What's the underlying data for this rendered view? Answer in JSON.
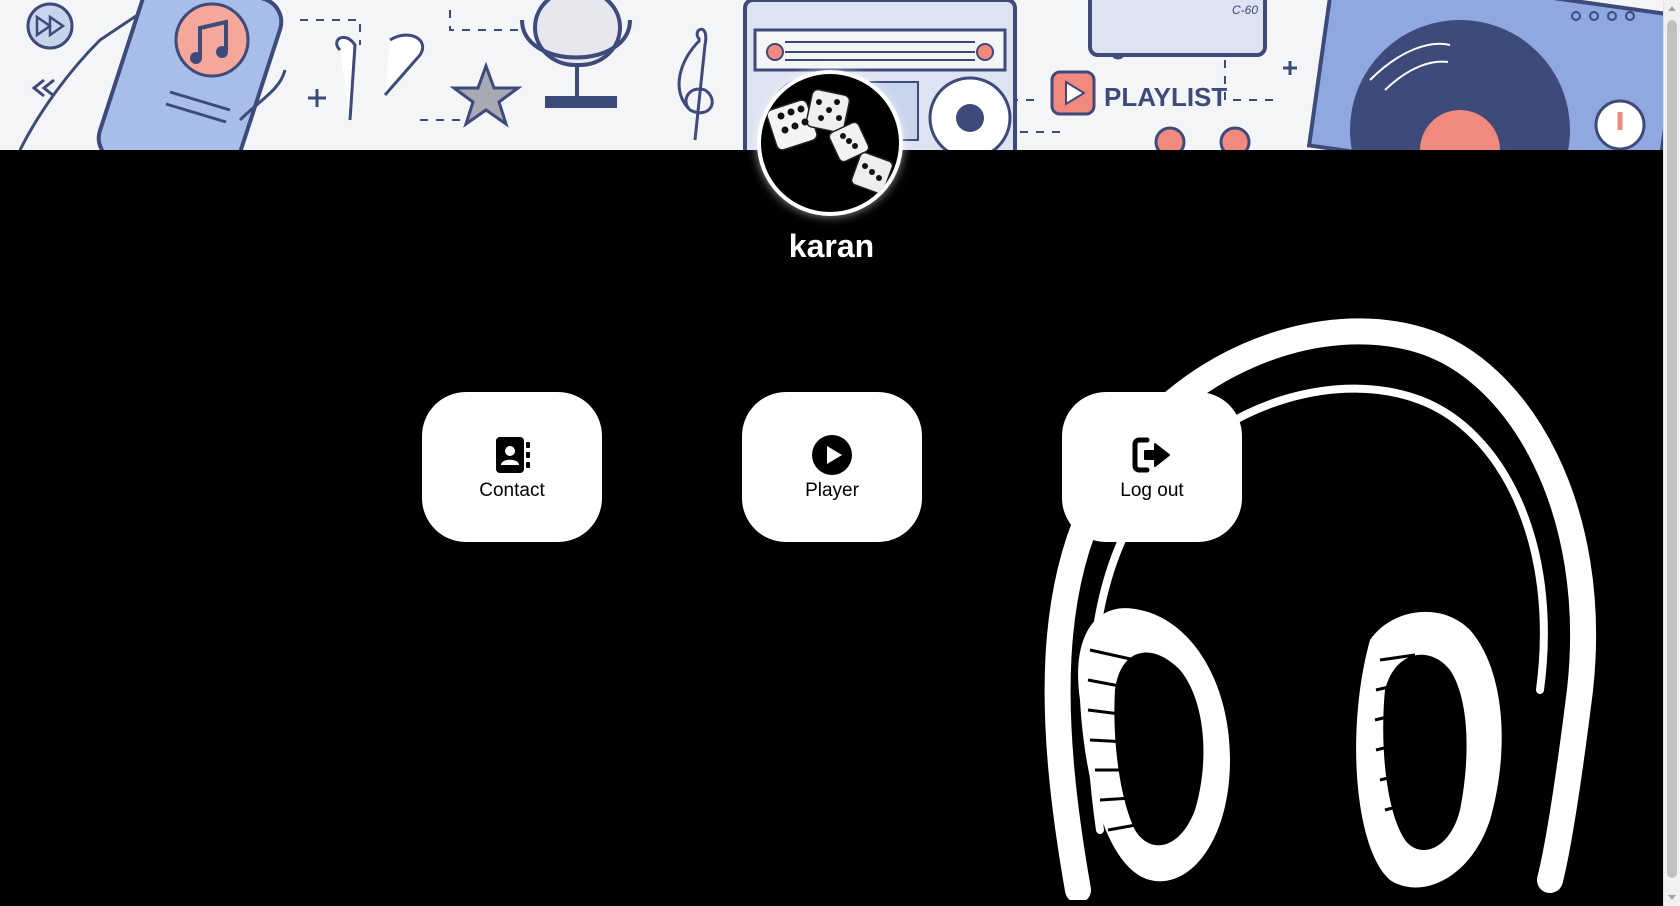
{
  "banner": {
    "playlist_text": "PLAYLIST",
    "cassette_text": "C-60"
  },
  "profile": {
    "username": "karan"
  },
  "menu": {
    "contact_label": "Contact",
    "player_label": "Player",
    "logout_label": "Log out"
  },
  "colors": {
    "background": "#000000",
    "card": "#ffffff",
    "banner_accent": "#f08a7e",
    "banner_navy": "#3d4a7a",
    "banner_blue": "#8fa8e0"
  }
}
